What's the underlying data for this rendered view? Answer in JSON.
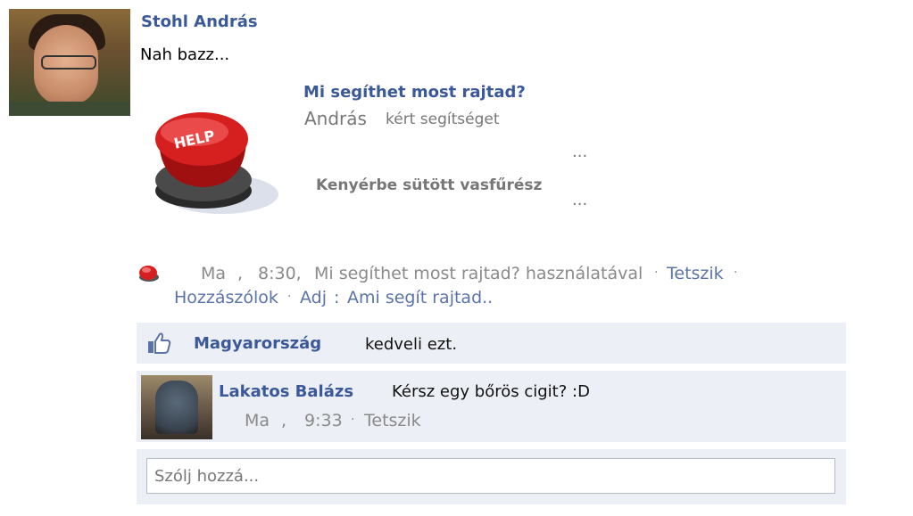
{
  "post": {
    "author": "Stohl András",
    "text": "Nah bazz...",
    "app_title": "Mi segíthet most rajtad?",
    "app_sub_name": "András",
    "app_sub_rest": "kért segítséget",
    "ellipsis": "...",
    "app_item": "Kenyérbe sütött vasfűrész",
    "help_button_label": "HELP"
  },
  "meta": {
    "day": "Ma",
    "comma": ",",
    "time": "8:30,",
    "via": "Mi segíthet most rajtad? használatával",
    "dot": "·",
    "like_link": "Tetszik",
    "comment_link": "Hozzászólok",
    "share_link": "Adj",
    "colon": ":",
    "app_link": "Ami segít rajtad.."
  },
  "likes": {
    "name": "Magyarország",
    "text": "kedveli ezt."
  },
  "comment": {
    "author": "Lakatos Balázs",
    "text": "Kérsz egy bőrös cigit? :D",
    "day": "Ma",
    "comma": ",",
    "time": "9:33",
    "dot": "·",
    "like_link": "Tetszik"
  },
  "reply": {
    "placeholder": "Szólj hozzá..."
  },
  "colors": {
    "link_blue": "#3b5998",
    "box_bg": "#eceff5",
    "help_red": "#d62020"
  },
  "icons": {
    "like": "thumbs-up-icon",
    "app": "red-button-icon"
  }
}
